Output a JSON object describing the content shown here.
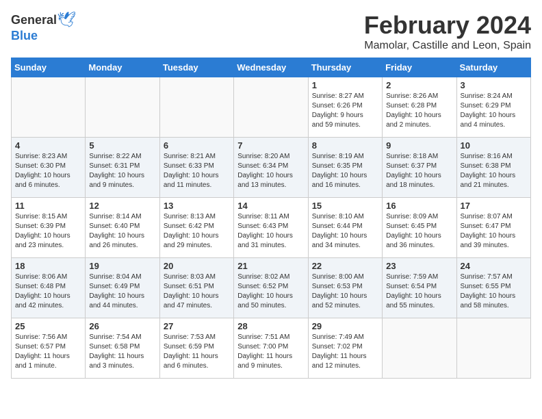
{
  "header": {
    "logo_general": "General",
    "logo_blue": "Blue",
    "title": "February 2024",
    "subtitle": "Mamolar, Castille and Leon, Spain"
  },
  "days_of_week": [
    "Sunday",
    "Monday",
    "Tuesday",
    "Wednesday",
    "Thursday",
    "Friday",
    "Saturday"
  ],
  "weeks": [
    [
      {
        "day": "",
        "info": ""
      },
      {
        "day": "",
        "info": ""
      },
      {
        "day": "",
        "info": ""
      },
      {
        "day": "",
        "info": ""
      },
      {
        "day": "1",
        "info": "Sunrise: 8:27 AM\nSunset: 6:26 PM\nDaylight: 9 hours\nand 59 minutes."
      },
      {
        "day": "2",
        "info": "Sunrise: 8:26 AM\nSunset: 6:28 PM\nDaylight: 10 hours\nand 2 minutes."
      },
      {
        "day": "3",
        "info": "Sunrise: 8:24 AM\nSunset: 6:29 PM\nDaylight: 10 hours\nand 4 minutes."
      }
    ],
    [
      {
        "day": "4",
        "info": "Sunrise: 8:23 AM\nSunset: 6:30 PM\nDaylight: 10 hours\nand 6 minutes."
      },
      {
        "day": "5",
        "info": "Sunrise: 8:22 AM\nSunset: 6:31 PM\nDaylight: 10 hours\nand 9 minutes."
      },
      {
        "day": "6",
        "info": "Sunrise: 8:21 AM\nSunset: 6:33 PM\nDaylight: 10 hours\nand 11 minutes."
      },
      {
        "day": "7",
        "info": "Sunrise: 8:20 AM\nSunset: 6:34 PM\nDaylight: 10 hours\nand 13 minutes."
      },
      {
        "day": "8",
        "info": "Sunrise: 8:19 AM\nSunset: 6:35 PM\nDaylight: 10 hours\nand 16 minutes."
      },
      {
        "day": "9",
        "info": "Sunrise: 8:18 AM\nSunset: 6:37 PM\nDaylight: 10 hours\nand 18 minutes."
      },
      {
        "day": "10",
        "info": "Sunrise: 8:16 AM\nSunset: 6:38 PM\nDaylight: 10 hours\nand 21 minutes."
      }
    ],
    [
      {
        "day": "11",
        "info": "Sunrise: 8:15 AM\nSunset: 6:39 PM\nDaylight: 10 hours\nand 23 minutes."
      },
      {
        "day": "12",
        "info": "Sunrise: 8:14 AM\nSunset: 6:40 PM\nDaylight: 10 hours\nand 26 minutes."
      },
      {
        "day": "13",
        "info": "Sunrise: 8:13 AM\nSunset: 6:42 PM\nDaylight: 10 hours\nand 29 minutes."
      },
      {
        "day": "14",
        "info": "Sunrise: 8:11 AM\nSunset: 6:43 PM\nDaylight: 10 hours\nand 31 minutes."
      },
      {
        "day": "15",
        "info": "Sunrise: 8:10 AM\nSunset: 6:44 PM\nDaylight: 10 hours\nand 34 minutes."
      },
      {
        "day": "16",
        "info": "Sunrise: 8:09 AM\nSunset: 6:45 PM\nDaylight: 10 hours\nand 36 minutes."
      },
      {
        "day": "17",
        "info": "Sunrise: 8:07 AM\nSunset: 6:47 PM\nDaylight: 10 hours\nand 39 minutes."
      }
    ],
    [
      {
        "day": "18",
        "info": "Sunrise: 8:06 AM\nSunset: 6:48 PM\nDaylight: 10 hours\nand 42 minutes."
      },
      {
        "day": "19",
        "info": "Sunrise: 8:04 AM\nSunset: 6:49 PM\nDaylight: 10 hours\nand 44 minutes."
      },
      {
        "day": "20",
        "info": "Sunrise: 8:03 AM\nSunset: 6:51 PM\nDaylight: 10 hours\nand 47 minutes."
      },
      {
        "day": "21",
        "info": "Sunrise: 8:02 AM\nSunset: 6:52 PM\nDaylight: 10 hours\nand 50 minutes."
      },
      {
        "day": "22",
        "info": "Sunrise: 8:00 AM\nSunset: 6:53 PM\nDaylight: 10 hours\nand 52 minutes."
      },
      {
        "day": "23",
        "info": "Sunrise: 7:59 AM\nSunset: 6:54 PM\nDaylight: 10 hours\nand 55 minutes."
      },
      {
        "day": "24",
        "info": "Sunrise: 7:57 AM\nSunset: 6:55 PM\nDaylight: 10 hours\nand 58 minutes."
      }
    ],
    [
      {
        "day": "25",
        "info": "Sunrise: 7:56 AM\nSunset: 6:57 PM\nDaylight: 11 hours\nand 1 minute."
      },
      {
        "day": "26",
        "info": "Sunrise: 7:54 AM\nSunset: 6:58 PM\nDaylight: 11 hours\nand 3 minutes."
      },
      {
        "day": "27",
        "info": "Sunrise: 7:53 AM\nSunset: 6:59 PM\nDaylight: 11 hours\nand 6 minutes."
      },
      {
        "day": "28",
        "info": "Sunrise: 7:51 AM\nSunset: 7:00 PM\nDaylight: 11 hours\nand 9 minutes."
      },
      {
        "day": "29",
        "info": "Sunrise: 7:49 AM\nSunset: 7:02 PM\nDaylight: 11 hours\nand 12 minutes."
      },
      {
        "day": "",
        "info": ""
      },
      {
        "day": "",
        "info": ""
      }
    ]
  ]
}
